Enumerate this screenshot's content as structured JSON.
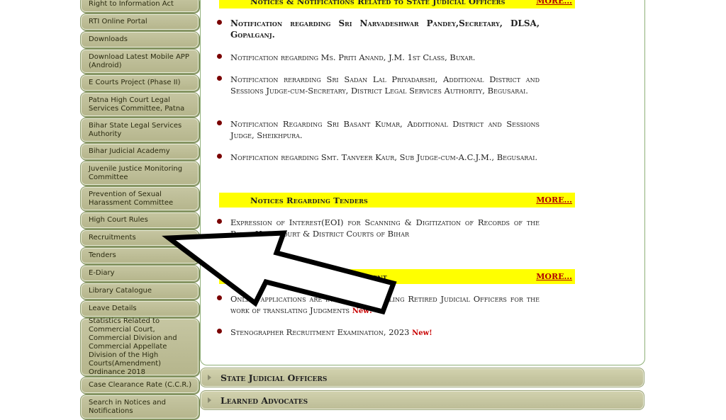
{
  "sidebar": {
    "items": [
      {
        "label": "Right to Information Act"
      },
      {
        "label": "RTI Online Portal"
      },
      {
        "label": "Downloads"
      },
      {
        "label": "Download Latest Mobile APP (Android)"
      },
      {
        "label": "E Courts Project (Phase II)"
      },
      {
        "label": "Patna High Court Legal Services Committee, Patna"
      },
      {
        "label": "Bihar State Legal Services Authority"
      },
      {
        "label": "Bihar Judicial Academy"
      },
      {
        "label": "Juvenile Justice Monitoring Committee"
      },
      {
        "label": "Prevention of Sexual Harassment Committee"
      },
      {
        "label": "High Court Rules"
      },
      {
        "label": "Recruitments"
      },
      {
        "label": "Tenders"
      },
      {
        "label": "E-Diary"
      },
      {
        "label": "Library Catalogue"
      },
      {
        "label": "Leave Details"
      },
      {
        "label": "Statistics Related to Commercial Court, Commercial Division and Commercial Appellate Division of the High Courts(Amendment) Ordinance 2018"
      },
      {
        "label": "Case Clearance Rate (C.C.R.)"
      },
      {
        "label": "Search in Notices and Notifications"
      }
    ]
  },
  "sections": {
    "officers": {
      "title": "Notices & Notifications Related to State Judicial Officers",
      "more": "MORE...",
      "items": [
        "Notification regarding Sri Narvadeshwar Pandey,Secretary, DLSA, Gopalganj.",
        "Notification regarding Ms. Priti Anand, J.M. 1st Class, Buxar.",
        "Notification rerarding Sri Sadan Lal Priyadarshi, Additional District and Sessions Judge-cum-Secretary, District Legal Services Authority, Begusarai.",
        "Notification Regarding Sri Basant Kumar, Additional District and Sessions Judge, Sheikhpura.",
        "Nofification regarding Smt. Tanveer Kaur, Sub Judge-cum-A.C.J.M., Begusarai."
      ]
    },
    "tenders": {
      "title": "Notices Regarding Tenders",
      "more": "MORE...",
      "items": [
        "Expression of Interest(EOI) for Scanning & Digitization of Records of the Patna High Court & District Courts of Bihar"
      ]
    },
    "recruitment": {
      "title": "Notices Regarding Recruitment",
      "more": "MORE...",
      "items": [
        "Online applications are invited from willing Retired Judicial Officers for the work of translating Judgments",
        "Stenographer Recruitment Examination, 2023"
      ]
    }
  },
  "badges": {
    "new": "New!"
  },
  "accordion": [
    {
      "label": "State Judicial Officers"
    },
    {
      "label": "Learned Advocates"
    }
  ],
  "colors": {
    "sidebar_button": "#bcbc96",
    "section_header": "#ffff00",
    "more_link": "#b00000",
    "bullet": "#7a0000",
    "new_badge": "#c80000"
  }
}
